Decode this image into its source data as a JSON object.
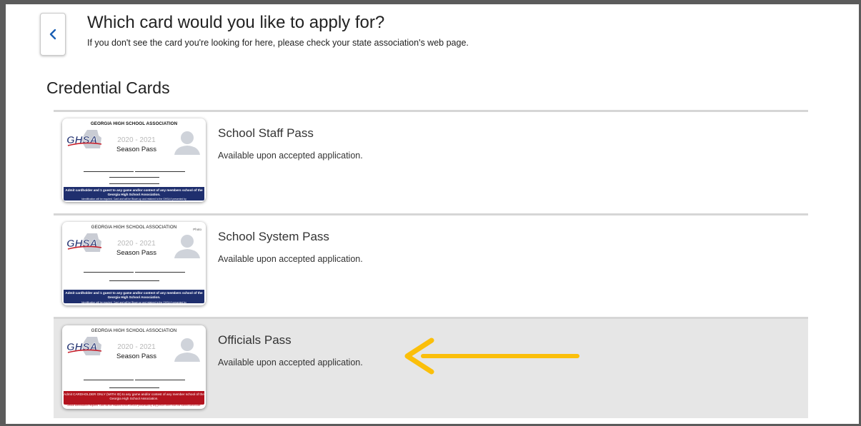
{
  "header": {
    "title": "Which card would you like to apply for?",
    "subtitle": "If you don't see the card you're looking for here, please check your state association's web page."
  },
  "section": {
    "heading": "Credential Cards"
  },
  "cards": [
    {
      "name": "School Staff Pass",
      "description": "Available upon accepted application.",
      "org": "GEORGIA HIGH SCHOOL ASSOCIATION",
      "logo_text": "GHSA",
      "year": "2020 - 2021",
      "season": "Season Pass",
      "band_text": "Admit cardholder and 1 guest to any game and/or contest of any members school of the Georgia High School Association.",
      "band_color": "#1f2f6e",
      "fine_print": "Identification will be required. Card and will be Blown up and retained to the GHSA if presented by"
    },
    {
      "name": "School System Pass",
      "description": "Available upon accepted application.",
      "org": "GEORGIA HIGH SCHOOL ASSOCIATION",
      "photo_label": "Photo",
      "logo_text": "GHSA",
      "year": "2020 - 2021",
      "season": "Season Pass",
      "band_text": "Admit cardholder and 1 guest to any game and/or contest of any members school of the Georgia High School Association.",
      "band_color": "#1f2f6e",
      "fine_print": "Identification will be required. Card and will be Blown up and retained to the GHSA if presented by"
    },
    {
      "name": "Officials Pass",
      "description": "Available upon accepted application.",
      "org": "GEORGIA HIGH SCHOOL ASSOCIATION",
      "logo_text": "GHSA",
      "year": "2020 - 2021",
      "season": "Season Pass",
      "band_text": "Admit CARDHOLDER ONLY (WITH ID) to any game and/or contest of any member school of the Georgia High School Association.",
      "band_color": "#b3141f",
      "fine_print": "Official identification required. Card will be retained to the GHSA if presented by any person other than the named cardholder.",
      "selected": true
    }
  ],
  "colors": {
    "arrow": "#fbbf0a",
    "back_chevron": "#1a5fb4",
    "selected_row": "#e6e6e6"
  },
  "icons": {
    "back": "chevron-left-icon",
    "avatar": "user-silhouette-icon",
    "pointer": "arrow-left-icon"
  }
}
